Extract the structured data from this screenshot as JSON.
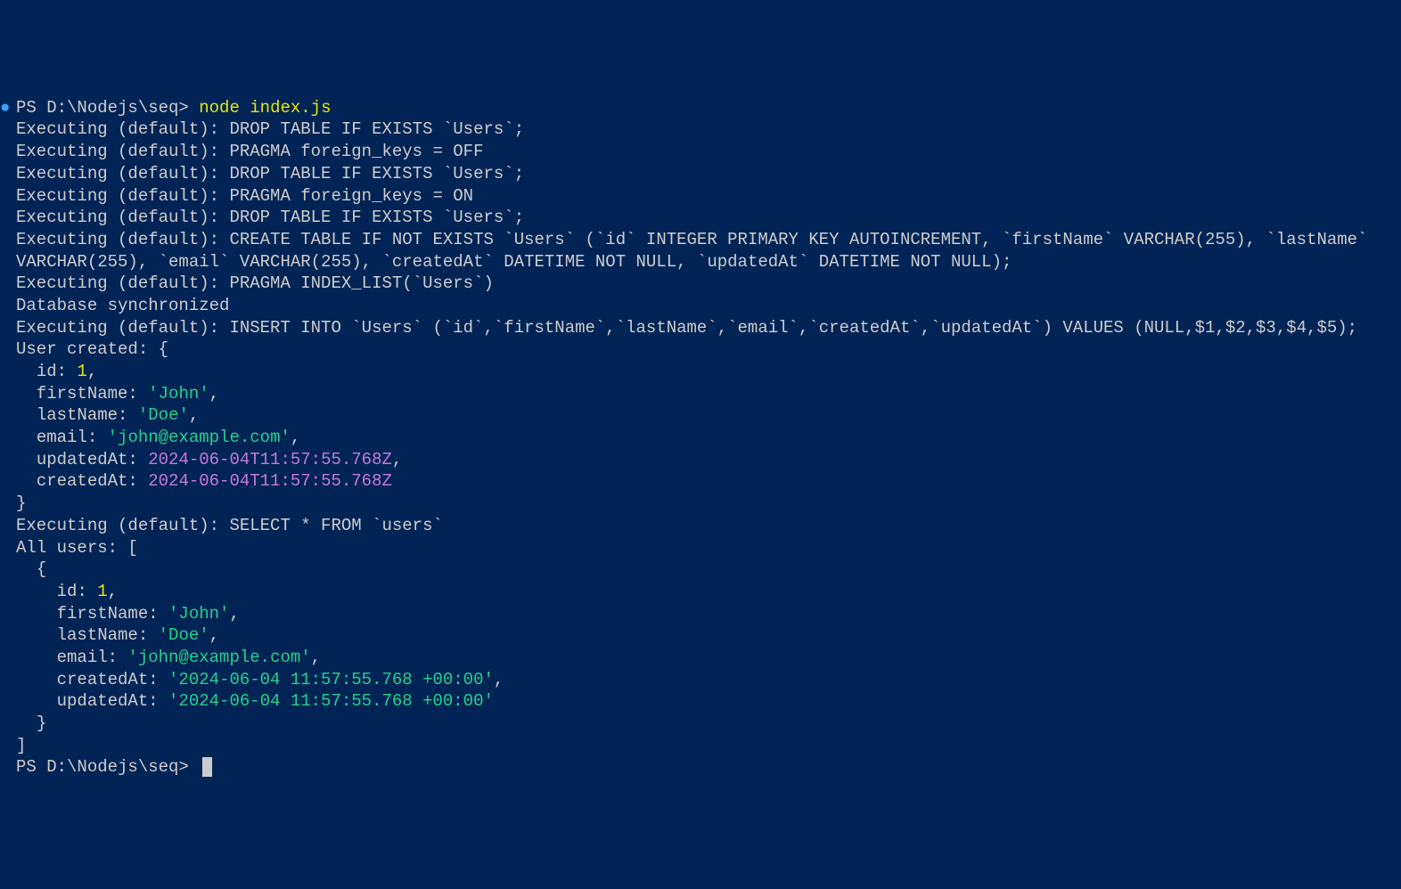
{
  "prompt1": {
    "path": "PS D:\\Nodejs\\seq>",
    "command": "node index.js"
  },
  "output": {
    "exec1": "Executing (default): DROP TABLE IF EXISTS `Users`;",
    "exec2": "Executing (default): PRAGMA foreign_keys = OFF",
    "exec3": "Executing (default): DROP TABLE IF EXISTS `Users`;",
    "exec4": "Executing (default): PRAGMA foreign_keys = ON",
    "exec5": "Executing (default): DROP TABLE IF EXISTS `Users`;",
    "exec6": "Executing (default): CREATE TABLE IF NOT EXISTS `Users` (`id` INTEGER PRIMARY KEY AUTOINCREMENT, `firstName` VARCHAR(255), `lastName` VARCHAR(255), `email` VARCHAR(255), `createdAt` DATETIME NOT NULL, `updatedAt` DATETIME NOT NULL);",
    "exec7": "Executing (default): PRAGMA INDEX_LIST(`Users`)",
    "dbSync": "Database synchronized",
    "exec8": "Executing (default): INSERT INTO `Users` (`id`,`firstName`,`lastName`,`email`,`createdAt`,`updatedAt`) VALUES (NULL,$1,$2,$3,$4,$5);",
    "userCreated": {
      "header": "User created: {",
      "idLabel": "  id: ",
      "idValue": "1",
      "idComma": ",",
      "firstNameLabel": "  firstName: ",
      "firstNameValue": "'John'",
      "firstNameComma": ",",
      "lastNameLabel": "  lastName: ",
      "lastNameValue": "'Doe'",
      "lastNameComma": ",",
      "emailLabel": "  email: ",
      "emailValue": "'john@example.com'",
      "emailComma": ",",
      "updatedAtLabel": "  updatedAt: ",
      "updatedAtValue": "2024-06-04T11:57:55.768Z",
      "updatedAtComma": ",",
      "createdAtLabel": "  createdAt: ",
      "createdAtValue": "2024-06-04T11:57:55.768Z",
      "close": "}"
    },
    "exec9": "Executing (default): SELECT * FROM `users`",
    "allUsers": {
      "header": "All users: [",
      "openBrace": "  {",
      "idLabel": "    id: ",
      "idValue": "1",
      "idComma": ",",
      "firstNameLabel": "    firstName: ",
      "firstNameValue": "'John'",
      "firstNameComma": ",",
      "lastNameLabel": "    lastName: ",
      "lastNameValue": "'Doe'",
      "lastNameComma": ",",
      "emailLabel": "    email: ",
      "emailValue": "'john@example.com'",
      "emailComma": ",",
      "createdAtLabel": "    createdAt: ",
      "createdAtValue": "'2024-06-04 11:57:55.768 +00:00'",
      "createdAtComma": ",",
      "updatedAtLabel": "    updatedAt: ",
      "updatedAtValue": "'2024-06-04 11:57:55.768 +00:00'",
      "closeBrace": "  }",
      "closeBracket": "]"
    }
  },
  "prompt2": {
    "path": "PS D:\\Nodejs\\seq>"
  }
}
